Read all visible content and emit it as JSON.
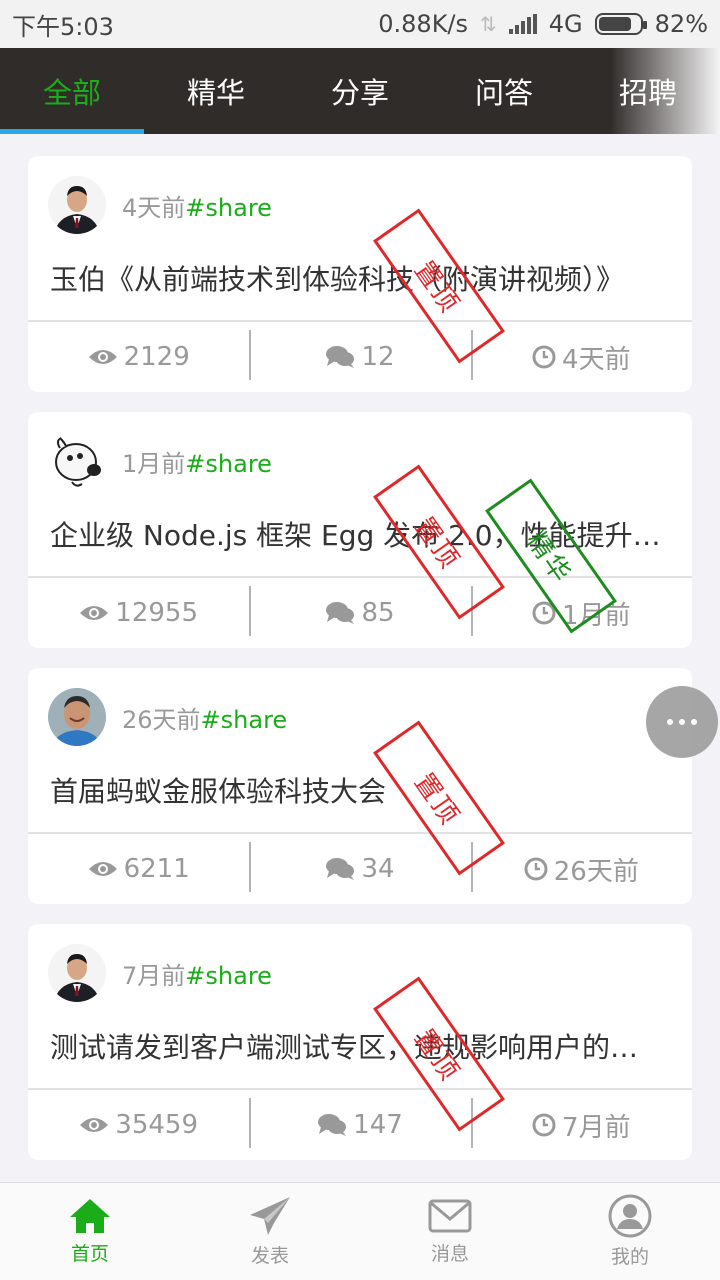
{
  "status_bar": {
    "time": "下午5:03",
    "speed": "0.88K/s",
    "network": "4G",
    "battery": "82%",
    "battery_level": 0.82
  },
  "tabs": [
    {
      "label": "全部",
      "active": true
    },
    {
      "label": "精华",
      "active": false
    },
    {
      "label": "分享",
      "active": false
    },
    {
      "label": "问答",
      "active": false
    },
    {
      "label": "招聘",
      "active": false
    }
  ],
  "posts": [
    {
      "time": "4天前",
      "tag": "#share",
      "title": "玉伯《从前端技术到体验科技（附演讲视频）》",
      "views": "2129",
      "replies": "12",
      "last_reply": "4天前",
      "stamps": [
        "置顶"
      ]
    },
    {
      "time": "1月前",
      "tag": "#share",
      "title": "企业级 Node.js 框架 Egg 发布 2.0，性能提升…",
      "views": "12955",
      "replies": "85",
      "last_reply": "1月前",
      "stamps": [
        "置顶",
        "精华"
      ]
    },
    {
      "time": "26天前",
      "tag": "#share",
      "title": "首届蚂蚁金服体验科技大会",
      "views": "6211",
      "replies": "34",
      "last_reply": "26天前",
      "stamps": [
        "置顶"
      ]
    },
    {
      "time": "7月前",
      "tag": "#share",
      "title": "测试请发到客户端测试专区，违规影响用户的…",
      "views": "35459",
      "replies": "147",
      "last_reply": "7月前",
      "stamps": [
        "置顶"
      ]
    }
  ],
  "bottom_nav": [
    {
      "label": "首页",
      "icon": "home-icon",
      "active": true
    },
    {
      "label": "发表",
      "icon": "send-icon",
      "active": false
    },
    {
      "label": "消息",
      "icon": "mail-icon",
      "active": false
    },
    {
      "label": "我的",
      "icon": "user-icon",
      "active": false
    }
  ],
  "colors": {
    "accent": "#1aad19",
    "tabbar_bg": "#302c2a",
    "tab_indicator": "#2aa7e8",
    "stamp_top": "#e0282b",
    "stamp_good": "#1e8c1e"
  }
}
